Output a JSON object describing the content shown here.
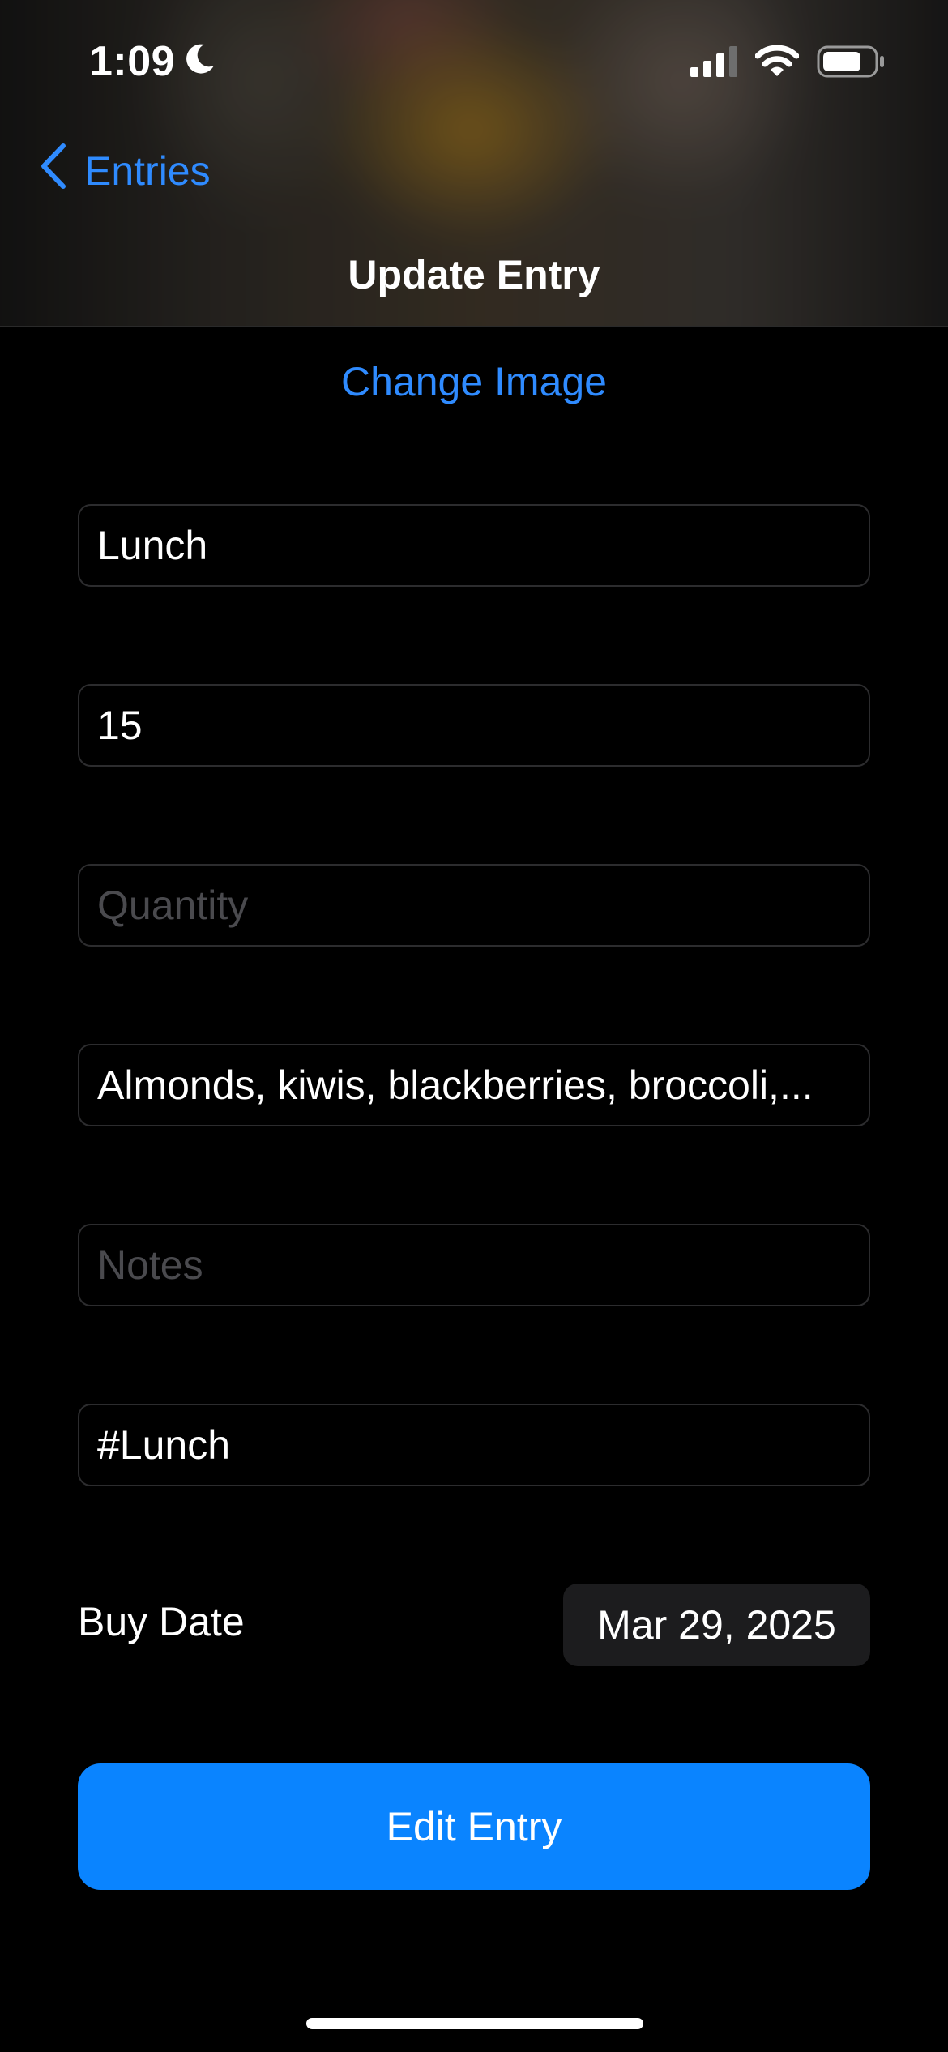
{
  "status_bar": {
    "time": "1:09",
    "icons": [
      "moon-icon",
      "cellular-signal-icon",
      "wifi-icon",
      "battery-icon"
    ]
  },
  "nav": {
    "back_label": "Entries",
    "title": "Update Entry"
  },
  "change_image_label": "Change Image",
  "form": {
    "name_value": "Lunch",
    "amount_value": "15",
    "quantity_placeholder": "Quantity",
    "ingredients_value": "Almonds, kiwis, blackberries, broccoli,...",
    "notes_placeholder": "Notes",
    "tags_value": "#Lunch",
    "buy_date_label": "Buy Date",
    "buy_date_value": "Mar 29, 2025"
  },
  "submit_label": "Edit Entry",
  "colors": {
    "accent": "#0A84FF",
    "link": "#2F8BFF",
    "background": "#000000",
    "field_border": "#2C2C2E",
    "chip_bg": "#1C1C1E"
  }
}
